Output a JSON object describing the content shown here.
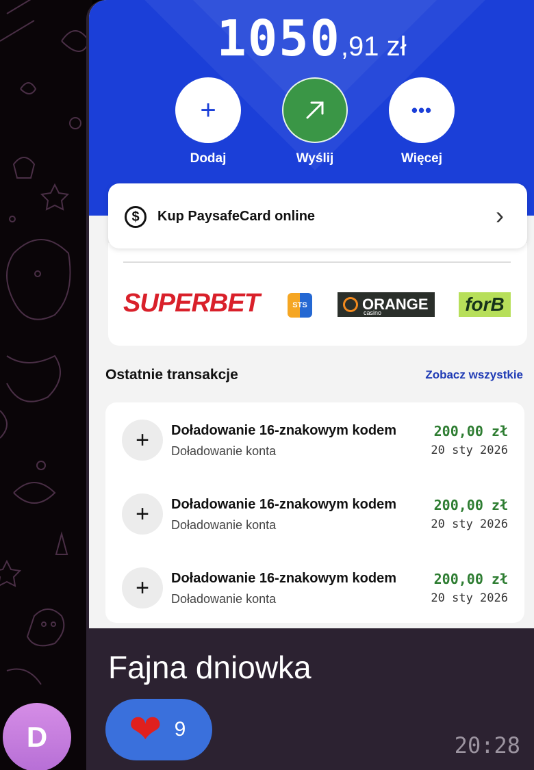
{
  "avatar": {
    "initial": "D",
    "color": "#c47edf"
  },
  "wallet": {
    "balance_main": "1050",
    "balance_fraction": ",91 zł",
    "accent_color": "#1b3fd8",
    "actions": [
      {
        "label": "Dodaj",
        "icon": "plus-icon"
      },
      {
        "label": "Wyślij",
        "icon": "arrow-up-right-icon"
      },
      {
        "label": "Więcej",
        "icon": "more-dots-icon"
      }
    ]
  },
  "promo": {
    "label": "Kup PaysafeCard online",
    "icon": "dollar-circle-icon"
  },
  "partners": [
    "SUPERBET",
    "STS",
    "ORANGE",
    "forB"
  ],
  "partners_sub": {
    "orange_sub": "casino"
  },
  "transactions": {
    "header": "Ostatnie transakcje",
    "see_all": "Zobacz wszystkie",
    "items": [
      {
        "title": "Doładowanie 16-znakowym kodem",
        "subtitle": "Doładowanie konta",
        "amount": "200,00 zł",
        "date": "20 sty 2026"
      },
      {
        "title": "Doładowanie 16-znakowym kodem",
        "subtitle": "Doładowanie konta",
        "amount": "200,00 zł",
        "date": "20 sty 2026"
      },
      {
        "title": "Doładowanie 16-znakowym kodem",
        "subtitle": "Doładowanie konta",
        "amount": "200,00 zł",
        "date": "20 sty 2026"
      }
    ]
  },
  "message": {
    "text": "Fajna dniowka",
    "reaction": {
      "emoji": "❤️",
      "count": "9"
    },
    "time": "20:28"
  }
}
